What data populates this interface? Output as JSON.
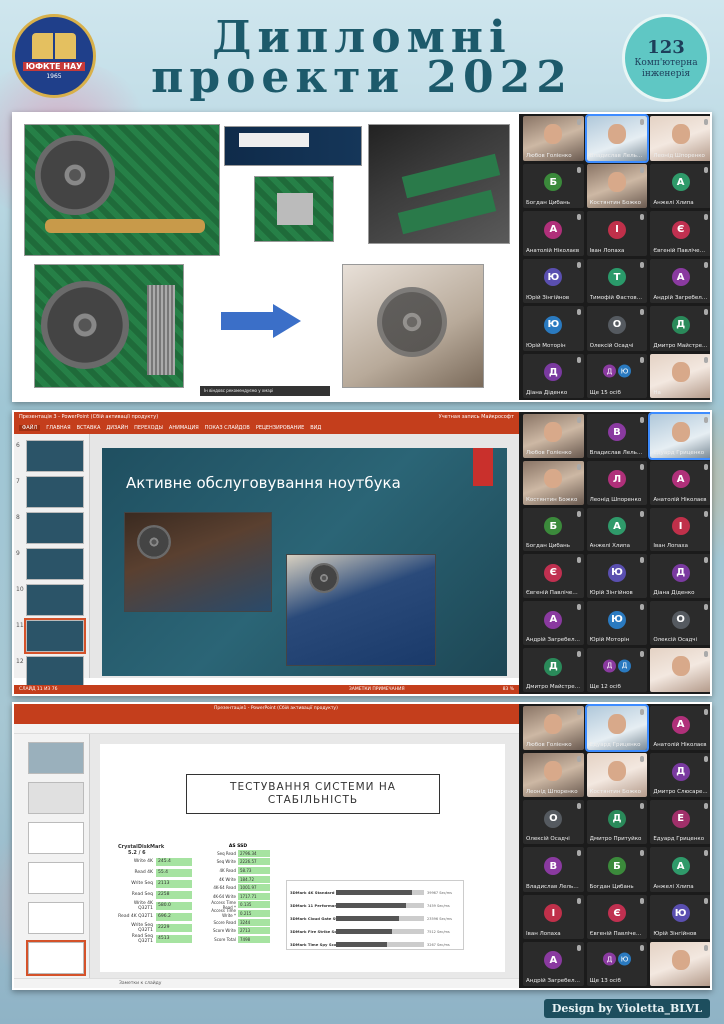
{
  "header": {
    "title_line1": "Дипломні",
    "title_line2": "проекти 2022",
    "logo_left": {
      "name": "ЮФКТЕ НАУ",
      "year": "1965"
    },
    "logo_right": {
      "number": "123",
      "text_line1": "Комп'ютерна",
      "text_line2": "інженерія"
    }
  },
  "panel1": {
    "notice": "Iн віндовс рекомендуємо у хмарі",
    "participants": [
      {
        "name": "Любов Голієнко",
        "type": "video1"
      },
      {
        "name": "Владислав Лельк...",
        "type": "video2",
        "active": true
      },
      {
        "name": "Леонід Шпоренко",
        "type": "video3"
      },
      {
        "name": "Богдан Цибань",
        "initial": "Б",
        "color": "#3b8a3b"
      },
      {
        "name": "Костянтин Божко",
        "type": "video1"
      },
      {
        "name": "Анжелі Хлипа",
        "initial": "А",
        "color": "#2f9a6a"
      },
      {
        "name": "Анатолій Ніколаєв",
        "initial": "А",
        "color": "#b0307a"
      },
      {
        "name": "Іван Лопаха",
        "initial": "І",
        "color": "#c0304a"
      },
      {
        "name": "Євгеній Павліченко",
        "initial": "Є",
        "color": "#c03050"
      },
      {
        "name": "Юрій Зінгійнов",
        "initial": "Ю",
        "color": "#5a4fb0"
      },
      {
        "name": "Тимофій Фастовець",
        "initial": "Т",
        "color": "#2a9a6a"
      },
      {
        "name": "Андрій Загребель...",
        "initial": "А",
        "color": "#8a3aa0"
      },
      {
        "name": "Юрій Моторін",
        "initial": "Ю",
        "color": "#2a7ac0"
      },
      {
        "name": "Олексій Осадчі",
        "initial": "О",
        "color": "#555a60"
      },
      {
        "name": "Дмитро Майстре...",
        "initial": "Д",
        "color": "#2a8a5a"
      },
      {
        "name": "Діана Діденко",
        "initial": "Д",
        "color": "#7a3aa0"
      },
      {
        "name": "Ще 15 осіб",
        "pair": [
          "Д",
          "Ю"
        ],
        "more": true
      },
      {
        "name": "На",
        "type": "video3"
      }
    ]
  },
  "panel2": {
    "app_title": "Презентація 3 - PowerPoint (Сбій активації продукту)",
    "account": "Учетная запись Майкрософт",
    "menu": [
      "ФАЙЛ",
      "ГЛАВНАЯ",
      "ВСТАВКА",
      "ДИЗАЙН",
      "ПЕРЕХОДЫ",
      "АНИМАЦИЯ",
      "ПОКАЗ СЛАЙДОВ",
      "РЕЦЕНЗИРОВАНИЕ",
      "ВИД"
    ],
    "thumb_numbers": [
      "6",
      "7",
      "8",
      "9",
      "10",
      "11",
      "12"
    ],
    "slide_title": "Активне обслуговування ноутбука",
    "status_left": "СЛАЙД 11 ИЗ 76",
    "status_right": "ЗАМЕТКИ   ПРИМЕЧАНИЯ",
    "zoom": "83 %",
    "participants": [
      {
        "name": "Любов Голієнко",
        "type": "video1"
      },
      {
        "name": "Владислав Лельк...",
        "initial": "В",
        "color": "#8a3aa0"
      },
      {
        "name": "Едуард Гриценко",
        "type": "video2",
        "active": true
      },
      {
        "name": "Костянтин Божко",
        "type": "video1"
      },
      {
        "name": "Леонід Шпоренко",
        "initial": "Л",
        "color": "#b0307a"
      },
      {
        "name": "Анатолій Ніколаєв",
        "initial": "А",
        "color": "#b0307a"
      },
      {
        "name": "Богдан Цибань",
        "initial": "Б",
        "color": "#3b8a3b"
      },
      {
        "name": "Анжелі Хлипа",
        "initial": "А",
        "color": "#2f9a6a"
      },
      {
        "name": "Іван Лопаха",
        "initial": "І",
        "color": "#c0304a"
      },
      {
        "name": "Євгеній Павліченко",
        "initial": "Є",
        "color": "#c03050"
      },
      {
        "name": "Юрій Зінгійнов",
        "initial": "Ю",
        "color": "#5a4fb0"
      },
      {
        "name": "Діана Діденко",
        "initial": "Д",
        "color": "#7a3aa0"
      },
      {
        "name": "Андрій Загребель...",
        "initial": "А",
        "color": "#8a3aa0"
      },
      {
        "name": "Юрій Моторін",
        "initial": "Ю",
        "color": "#2a7ac0"
      },
      {
        "name": "Олексій Осадчі",
        "initial": "О",
        "color": "#555a60"
      },
      {
        "name": "Дмитро Майстрен...",
        "initial": "Д",
        "color": "#2a8a5a"
      },
      {
        "name": "Ще 12 осіб",
        "pair": [
          "Д",
          "Д"
        ],
        "more": true
      },
      {
        "name": "",
        "type": "video3"
      }
    ]
  },
  "panel3": {
    "app_title": "Презентація1 - PowerPoint (Сбій активації продукту)",
    "slide_title": "ТЕСТУВАННЯ СИСТЕМИ НА СТАБІЛЬНІСТЬ",
    "crystal": {
      "title": "CrystalDiskMark",
      "version": "5.2 / 6",
      "rows": [
        {
          "k": "Write 4K",
          "v": "245.4"
        },
        {
          "k": "Read 4K",
          "v": "55.4"
        },
        {
          "k": "Write Seq",
          "v": "2113"
        },
        {
          "k": "Read Seq",
          "v": "2258"
        },
        {
          "k": "Write 4K Q32T1",
          "v": "580.0"
        },
        {
          "k": "Read 4K Q32T1",
          "v": "696.2"
        },
        {
          "k": "Write Seq Q32T1",
          "v": "2229"
        },
        {
          "k": "Read Seq Q32T1",
          "v": "4513"
        }
      ]
    },
    "as": {
      "title": "AS SSD",
      "rows": [
        {
          "k": "Seq Read",
          "v": "2796.34"
        },
        {
          "k": "Seq Write",
          "v": "2226.57"
        },
        {
          "k": "4K Read",
          "v": "58.73"
        },
        {
          "k": "4K Write",
          "v": "184.72"
        },
        {
          "k": "4K-64 Read",
          "v": "1001.97"
        },
        {
          "k": "4K-64 Write",
          "v": "1717.71"
        },
        {
          "k": "Access Time Read *",
          "v": "0.135"
        },
        {
          "k": "Access Time Write *",
          "v": "0.215"
        },
        {
          "k": "Score Read",
          "v": "3244"
        },
        {
          "k": "Score Write",
          "v": "2713"
        },
        {
          "k": "Score Total",
          "v": "7498"
        }
      ]
    },
    "bench": [
      {
        "k": "3DMark 4K Standard Score",
        "n": "39967 Sec/ms",
        "f": 0.86
      },
      {
        "k": "3DMark 11 Performance",
        "n": "7459 Sec/ms",
        "f": 0.8
      },
      {
        "k": "3DMark Cloud Gate Standard Score",
        "n": "23596 Sec/ms",
        "f": 0.72
      },
      {
        "k": "3DMark Fire Strike Score",
        "n": "7512 Sec/ms",
        "f": 0.64
      },
      {
        "k": "3DMark Time Spy Score",
        "n": "3267 Sec/ms",
        "f": 0.58
      }
    ],
    "status": "Заметки к слайду",
    "participants": [
      {
        "name": "Любов Голієнко",
        "type": "video1"
      },
      {
        "name": "Едуард Гриценко",
        "type": "video2",
        "active": true
      },
      {
        "name": "Анатолій Ніколаєв",
        "initial": "А",
        "color": "#b0307a"
      },
      {
        "name": "Леонід Шпоренко",
        "type": "video1"
      },
      {
        "name": "Костянтин Божко",
        "type": "video3"
      },
      {
        "name": "Дмитро Слюсаре...",
        "initial": "Д",
        "color": "#7a3aa0"
      },
      {
        "name": "Олексій Осадчі",
        "initial": "О",
        "color": "#555a60"
      },
      {
        "name": "Дмитро Притуйко",
        "initial": "Д",
        "color": "#2a8a5a"
      },
      {
        "name": "Едуард Гриценко",
        "initial": "Е",
        "color": "#a0306a"
      },
      {
        "name": "Владислав Лельк...",
        "initial": "В",
        "color": "#8a3aa0"
      },
      {
        "name": "Богдан Цибань",
        "initial": "Б",
        "color": "#3b8a3b"
      },
      {
        "name": "Анжелі Хлипа",
        "initial": "А",
        "color": "#2f9a6a"
      },
      {
        "name": "Іван Лопаха",
        "initial": "І",
        "color": "#c0304a"
      },
      {
        "name": "Євгеній Павліченко",
        "initial": "Є",
        "color": "#c03050"
      },
      {
        "name": "Юрій Зінгійнов",
        "initial": "Ю",
        "color": "#5a4fb0"
      },
      {
        "name": "Андрій Загребель...",
        "initial": "А",
        "color": "#8a3aa0"
      },
      {
        "name": "Ще 13 осіб",
        "pair": [
          "Д",
          "Ю"
        ],
        "more": true
      },
      {
        "name": "",
        "type": "video3"
      }
    ]
  },
  "credit": "Design by Violetta_BLVL",
  "colors": {
    "accent": "#1d5a6b",
    "powerpoint": "#c43e1c",
    "badge": "#5fc7c4"
  }
}
